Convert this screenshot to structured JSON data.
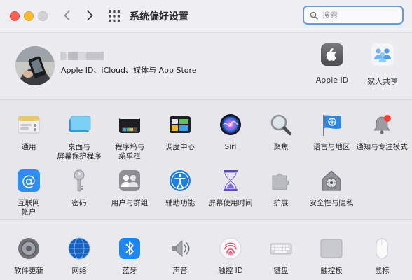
{
  "window": {
    "title": "系统偏好设置"
  },
  "search": {
    "placeholder": "搜索"
  },
  "account": {
    "subtitle": "Apple ID、iCloud、媒体与 App Store",
    "top_items": [
      {
        "label": "Apple ID",
        "icon": "apple-logo-icon"
      },
      {
        "label": "家人共享",
        "icon": "family-sharing-icon"
      }
    ]
  },
  "row1": [
    {
      "label": "通用",
      "icon": "general-icon"
    },
    {
      "label": "桌面与\n屏幕保护程序",
      "icon": "desktop-screensaver-icon"
    },
    {
      "label": "程序坞与\n菜单栏",
      "icon": "dock-menubar-icon"
    },
    {
      "label": "调度中心",
      "icon": "mission-control-icon"
    },
    {
      "label": "Siri",
      "icon": "siri-icon"
    },
    {
      "label": "聚焦",
      "icon": "spotlight-icon"
    },
    {
      "label": "语言与地区",
      "icon": "language-region-icon"
    },
    {
      "label": "通知与专注模式",
      "icon": "notifications-icon"
    }
  ],
  "row2": [
    {
      "label": "互联网\n帐户",
      "icon": "internet-accounts-icon"
    },
    {
      "label": "密码",
      "icon": "passwords-icon"
    },
    {
      "label": "用户与群组",
      "icon": "users-groups-icon"
    },
    {
      "label": "辅助功能",
      "icon": "accessibility-icon"
    },
    {
      "label": "屏幕使用时间",
      "icon": "screen-time-icon"
    },
    {
      "label": "扩展",
      "icon": "extensions-icon"
    },
    {
      "label": "安全性与隐私",
      "icon": "security-privacy-icon"
    }
  ],
  "row3": [
    {
      "label": "软件更新",
      "icon": "software-update-icon"
    },
    {
      "label": "网络",
      "icon": "network-icon"
    },
    {
      "label": "蓝牙",
      "icon": "bluetooth-icon"
    },
    {
      "label": "声音",
      "icon": "sound-icon"
    },
    {
      "label": "触控 ID",
      "icon": "touch-id-icon"
    },
    {
      "label": "键盘",
      "icon": "keyboard-icon"
    },
    {
      "label": "触控板",
      "icon": "trackpad-icon"
    },
    {
      "label": "鼠标",
      "icon": "mouse-icon"
    }
  ]
}
